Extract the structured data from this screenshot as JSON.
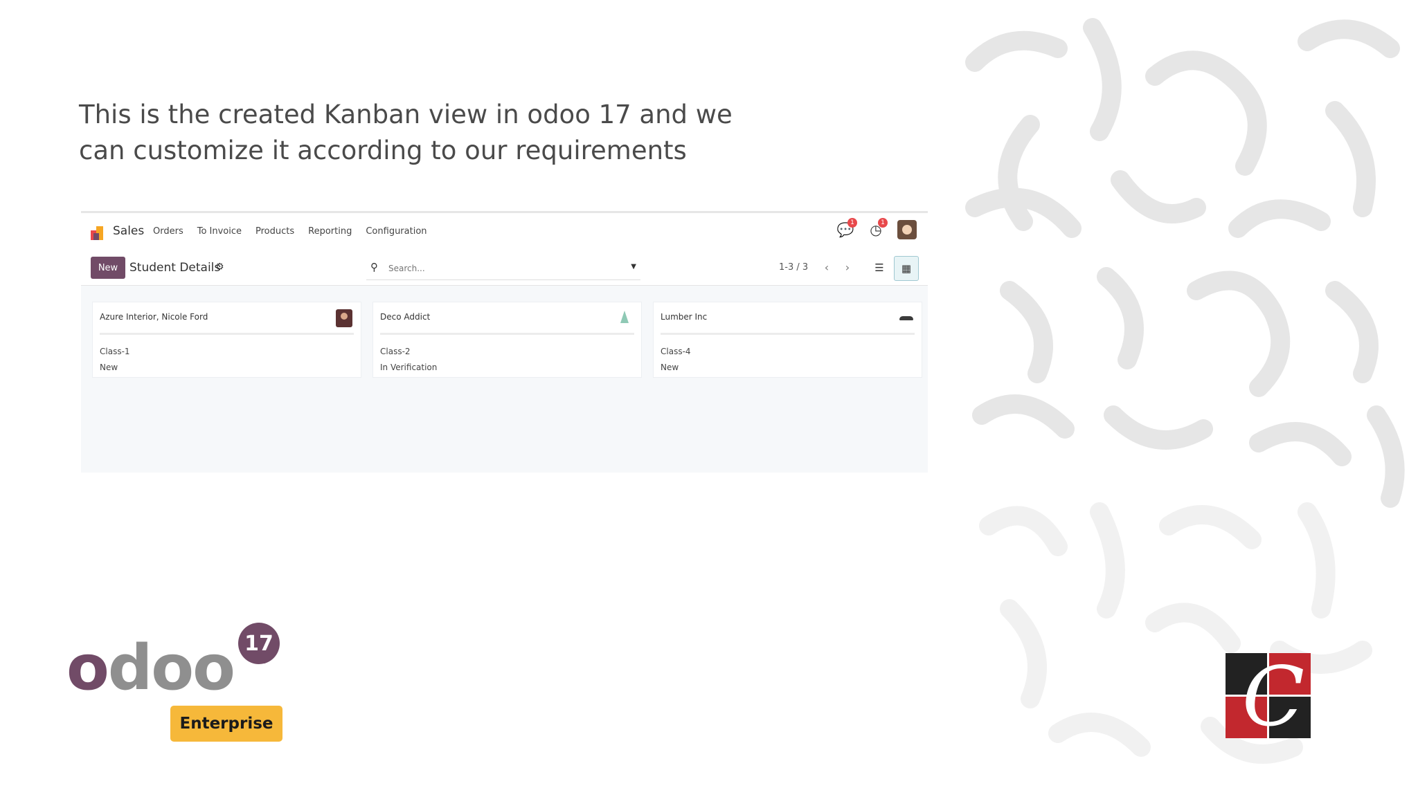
{
  "slide": {
    "caption": "This is the created Kanban view in odoo 17 and we can customize it according to our requirements"
  },
  "odoo_app": {
    "app_name": "Sales",
    "menu": [
      "Orders",
      "To Invoice",
      "Products",
      "Reporting",
      "Configuration"
    ],
    "notifications": {
      "messages_count": "1",
      "activities_count": "1"
    },
    "new_button_label": "New",
    "page_title": "Student Details",
    "search_placeholder": "Search...",
    "pager": "1-3 / 3",
    "cards": [
      {
        "name": "Azure Interior, Nicole Ford",
        "class": "Class-1",
        "state": "New",
        "image": "person-avatar"
      },
      {
        "name": "Deco Addict",
        "class": "Class-2",
        "state": "In Verification",
        "image": "plant-logo"
      },
      {
        "name": "Lumber Inc",
        "class": "Class-4",
        "state": "New",
        "image": "hat-logo"
      }
    ]
  },
  "logos": {
    "odoo_word": "odoo",
    "odoo_version": "17",
    "edition": "Enterprise"
  },
  "colors": {
    "odoo_purple": "#714b67",
    "enterprise_badge": "#f6b83a",
    "brand_red": "#c2282e",
    "brand_dark": "#222222"
  }
}
